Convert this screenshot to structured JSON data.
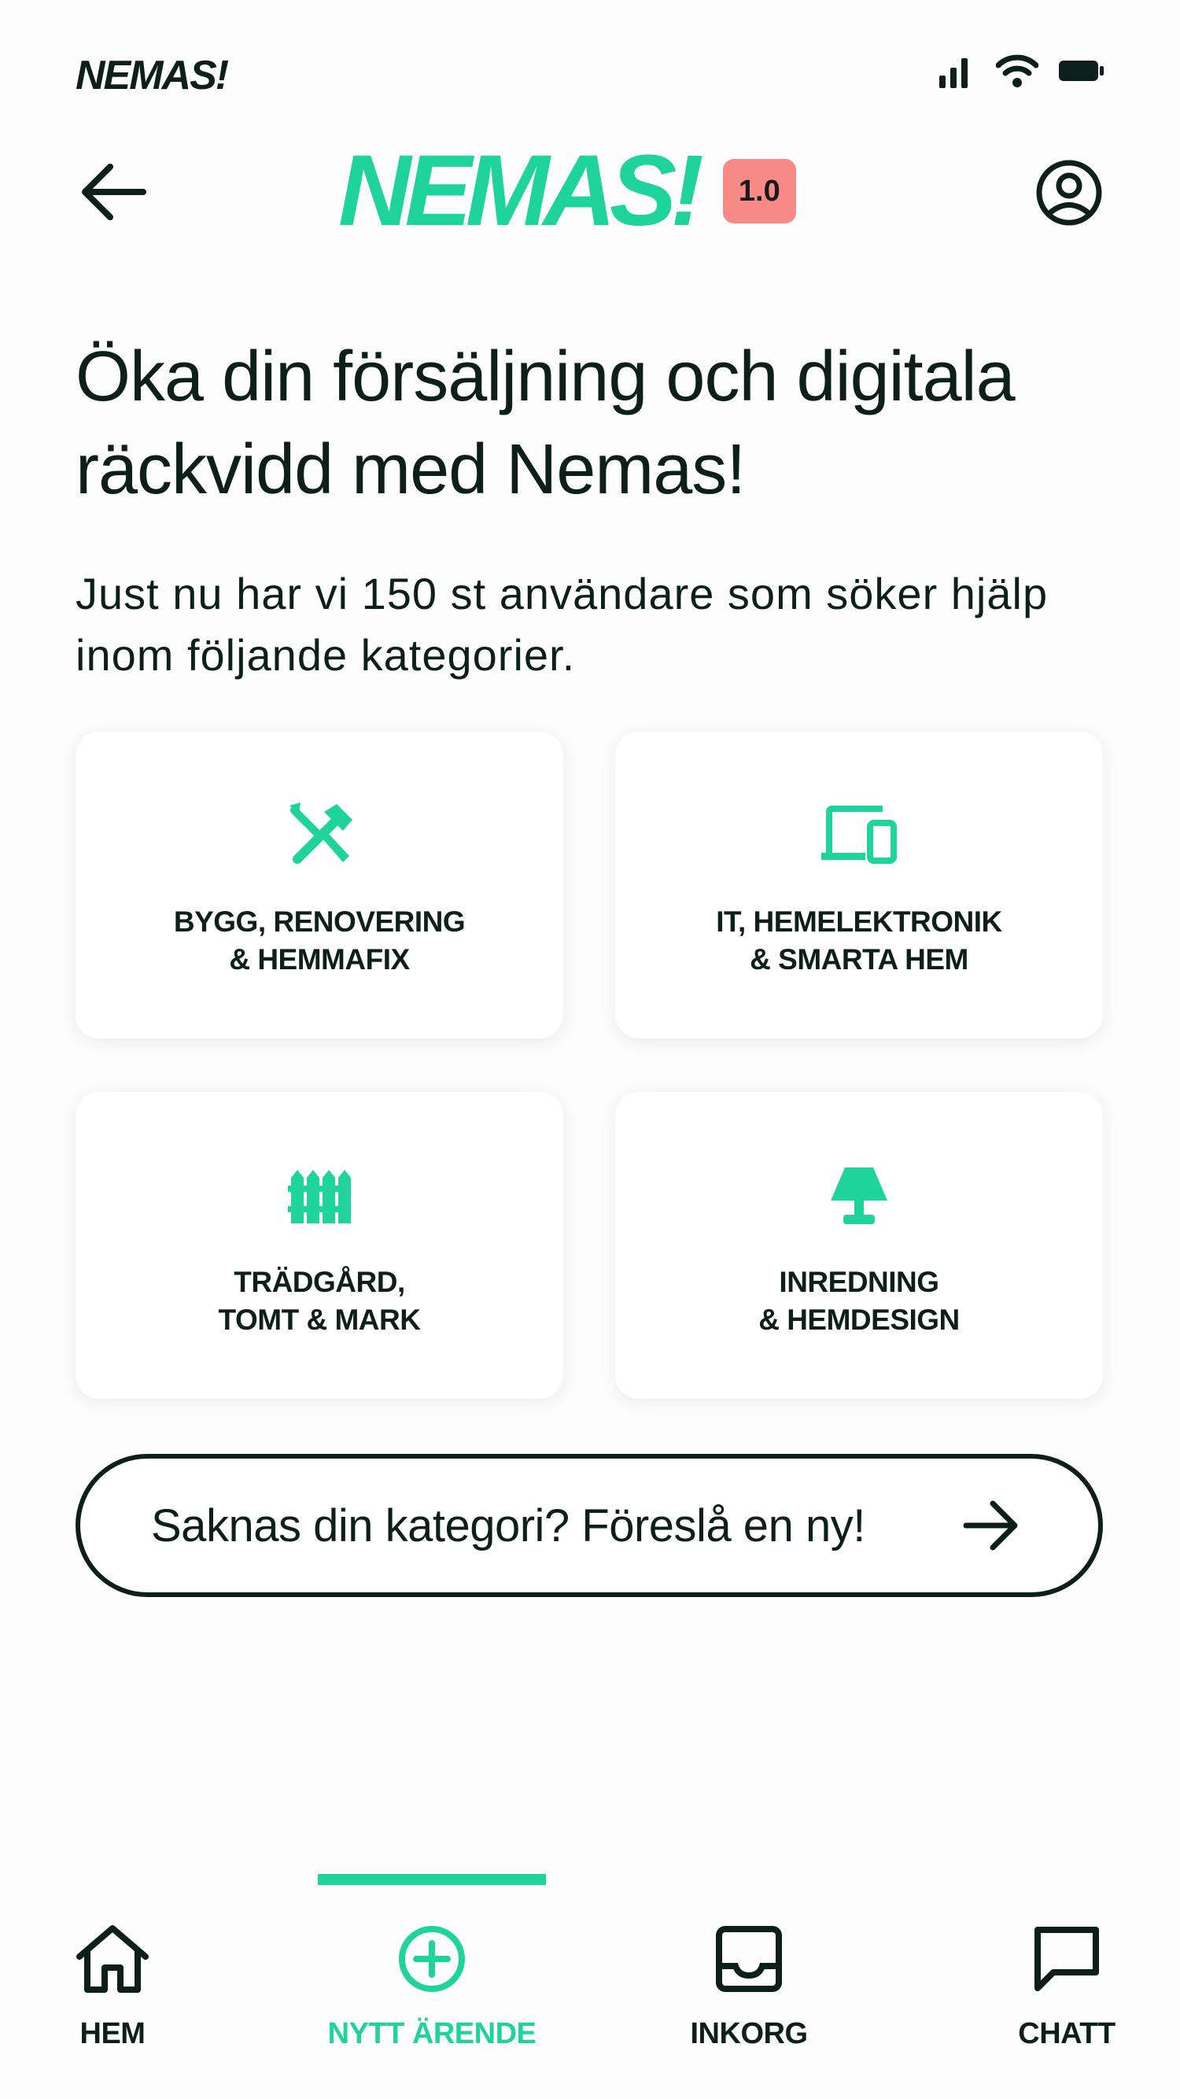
{
  "status_bar": {
    "brand": "NEMAS!",
    "icons": [
      "signal-icon",
      "wifi-icon",
      "battery-icon"
    ]
  },
  "header": {
    "logo": "NEMAS!",
    "version": "1.0",
    "back_icon": "arrow-left-icon",
    "profile_icon": "user-circle-icon"
  },
  "intro": {
    "headline": "Öka din försäljning och digitala räckvidd med Nemas!",
    "subline": "Just nu har vi 150 st användare som söker hjälp inom följande kategorier."
  },
  "categories": [
    {
      "label": "BYGG, RENOVERING\n& HEMMAFIX",
      "icon": "tools-icon"
    },
    {
      "label": "IT, HEMELEKTRONIK\n& SMARTA HEM",
      "icon": "devices-icon"
    },
    {
      "label": "TRÄDGÅRD,\nTOMT & MARK",
      "icon": "fence-icon"
    },
    {
      "label": "INREDNING\n& HEMDESIGN",
      "icon": "lamp-icon"
    }
  ],
  "suggest": {
    "label": "Saknas din kategori? Föreslå en ny!",
    "icon": "arrow-right-icon"
  },
  "nav": {
    "items": [
      {
        "label": "HEM",
        "icon": "home-icon"
      },
      {
        "label": "NYTT ÄRENDE",
        "icon": "plus-circle-icon",
        "active": true
      },
      {
        "label": "INKORG",
        "icon": "inbox-icon"
      },
      {
        "label": "CHATT",
        "icon": "chat-icon"
      }
    ]
  },
  "colors": {
    "accent": "#1ed49a",
    "text": "#0d1f1a",
    "badge": "#f78a86",
    "background": "#fdfdfd"
  }
}
